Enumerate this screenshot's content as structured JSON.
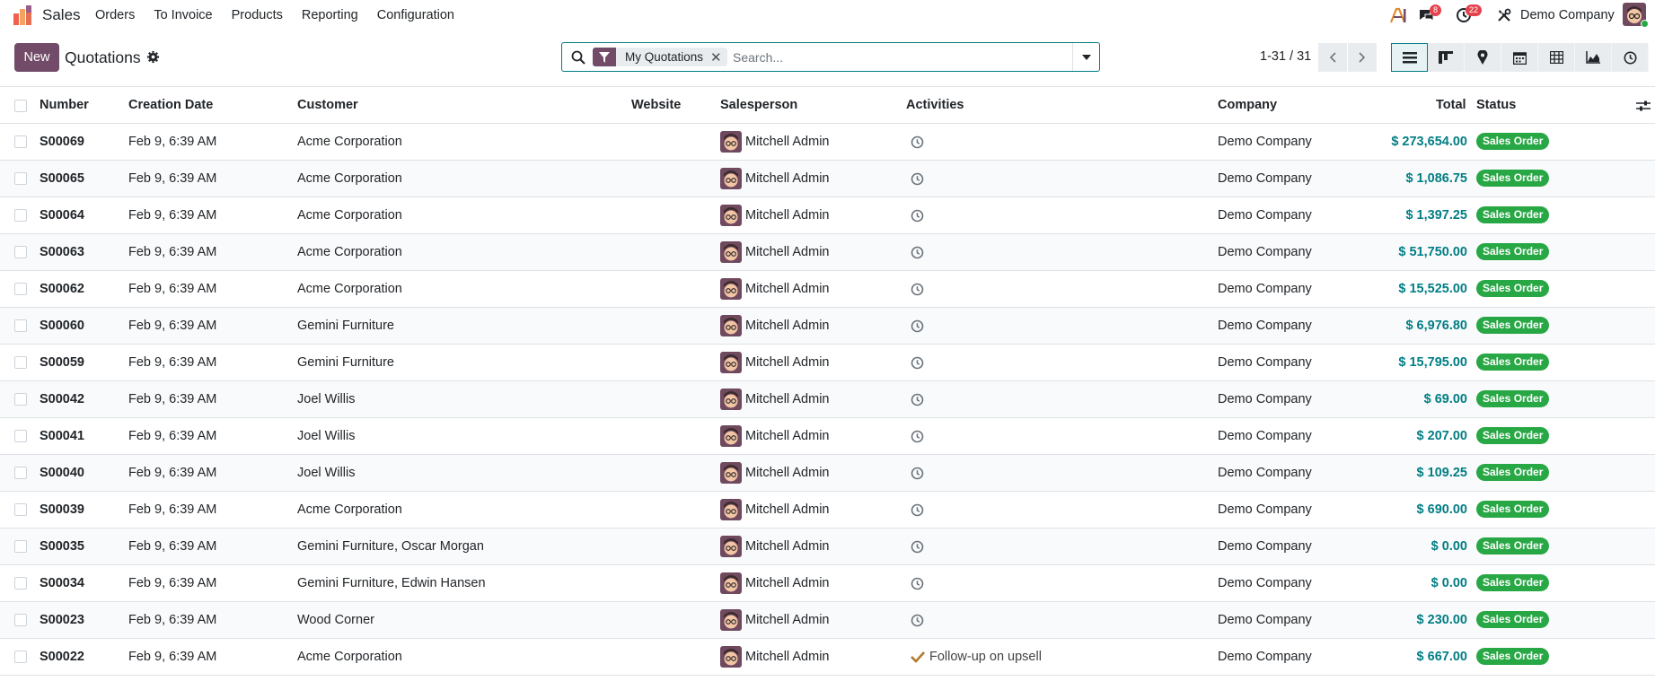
{
  "navbar": {
    "app_name": "Sales",
    "menu": [
      "Orders",
      "To Invoice",
      "Products",
      "Reporting",
      "Configuration"
    ],
    "messages_count": "8",
    "activities_count": "22",
    "company": "Demo Company"
  },
  "control": {
    "new_label": "New",
    "title": "Quotations",
    "facet_label": "My Quotations",
    "search_placeholder": "Search...",
    "pager": "1-31 / 31"
  },
  "table": {
    "headers": {
      "number": "Number",
      "creation_date": "Creation Date",
      "customer": "Customer",
      "website": "Website",
      "salesperson": "Salesperson",
      "activities": "Activities",
      "company": "Company",
      "total": "Total",
      "status": "Status"
    },
    "rows": [
      {
        "number": "S00069",
        "date": "Feb 9, 6:39 AM",
        "customer": "Acme Corporation",
        "salesperson": "Mitchell Admin",
        "activity": "",
        "company": "Demo Company",
        "total": "$ 273,654.00",
        "status": "Sales Order"
      },
      {
        "number": "S00065",
        "date": "Feb 9, 6:39 AM",
        "customer": "Acme Corporation",
        "salesperson": "Mitchell Admin",
        "activity": "",
        "company": "Demo Company",
        "total": "$ 1,086.75",
        "status": "Sales Order"
      },
      {
        "number": "S00064",
        "date": "Feb 9, 6:39 AM",
        "customer": "Acme Corporation",
        "salesperson": "Mitchell Admin",
        "activity": "",
        "company": "Demo Company",
        "total": "$ 1,397.25",
        "status": "Sales Order"
      },
      {
        "number": "S00063",
        "date": "Feb 9, 6:39 AM",
        "customer": "Acme Corporation",
        "salesperson": "Mitchell Admin",
        "activity": "",
        "company": "Demo Company",
        "total": "$ 51,750.00",
        "status": "Sales Order"
      },
      {
        "number": "S00062",
        "date": "Feb 9, 6:39 AM",
        "customer": "Acme Corporation",
        "salesperson": "Mitchell Admin",
        "activity": "",
        "company": "Demo Company",
        "total": "$ 15,525.00",
        "status": "Sales Order"
      },
      {
        "number": "S00060",
        "date": "Feb 9, 6:39 AM",
        "customer": "Gemini Furniture",
        "salesperson": "Mitchell Admin",
        "activity": "",
        "company": "Demo Company",
        "total": "$ 6,976.80",
        "status": "Sales Order"
      },
      {
        "number": "S00059",
        "date": "Feb 9, 6:39 AM",
        "customer": "Gemini Furniture",
        "salesperson": "Mitchell Admin",
        "activity": "",
        "company": "Demo Company",
        "total": "$ 15,795.00",
        "status": "Sales Order"
      },
      {
        "number": "S00042",
        "date": "Feb 9, 6:39 AM",
        "customer": "Joel Willis",
        "salesperson": "Mitchell Admin",
        "activity": "",
        "company": "Demo Company",
        "total": "$ 69.00",
        "status": "Sales Order"
      },
      {
        "number": "S00041",
        "date": "Feb 9, 6:39 AM",
        "customer": "Joel Willis",
        "salesperson": "Mitchell Admin",
        "activity": "",
        "company": "Demo Company",
        "total": "$ 207.00",
        "status": "Sales Order"
      },
      {
        "number": "S00040",
        "date": "Feb 9, 6:39 AM",
        "customer": "Joel Willis",
        "salesperson": "Mitchell Admin",
        "activity": "",
        "company": "Demo Company",
        "total": "$ 109.25",
        "status": "Sales Order"
      },
      {
        "number": "S00039",
        "date": "Feb 9, 6:39 AM",
        "customer": "Acme Corporation",
        "salesperson": "Mitchell Admin",
        "activity": "",
        "company": "Demo Company",
        "total": "$ 690.00",
        "status": "Sales Order"
      },
      {
        "number": "S00035",
        "date": "Feb 9, 6:39 AM",
        "customer": "Gemini Furniture, Oscar Morgan",
        "salesperson": "Mitchell Admin",
        "activity": "",
        "company": "Demo Company",
        "total": "$ 0.00",
        "status": "Sales Order"
      },
      {
        "number": "S00034",
        "date": "Feb 9, 6:39 AM",
        "customer": "Gemini Furniture, Edwin Hansen",
        "salesperson": "Mitchell Admin",
        "activity": "",
        "company": "Demo Company",
        "total": "$ 0.00",
        "status": "Sales Order"
      },
      {
        "number": "S00023",
        "date": "Feb 9, 6:39 AM",
        "customer": "Wood Corner",
        "salesperson": "Mitchell Admin",
        "activity": "",
        "company": "Demo Company",
        "total": "$ 230.00",
        "status": "Sales Order"
      },
      {
        "number": "S00022",
        "date": "Feb 9, 6:39 AM",
        "customer": "Acme Corporation",
        "salesperson": "Mitchell Admin",
        "activity": "Follow-up on upsell",
        "company": "Demo Company",
        "total": "$ 667.00",
        "status": "Sales Order"
      }
    ]
  },
  "colors": {
    "brand": "#714b67",
    "accent": "#017e84",
    "status_green": "#28a745",
    "badge_red": "#e4424d"
  },
  "icons": [
    "app-logo-icon",
    "ai-icon",
    "chat-icon",
    "clock-icon",
    "tools-icon",
    "gear-icon",
    "search-icon",
    "filter-icon",
    "close-icon",
    "chevron-down-icon",
    "chevron-left-icon",
    "chevron-right-icon",
    "list-view-icon",
    "kanban-view-icon",
    "map-view-icon",
    "calendar-view-icon",
    "pivot-view-icon",
    "graph-view-icon",
    "activity-view-icon",
    "optional-columns-icon",
    "check-icon"
  ]
}
